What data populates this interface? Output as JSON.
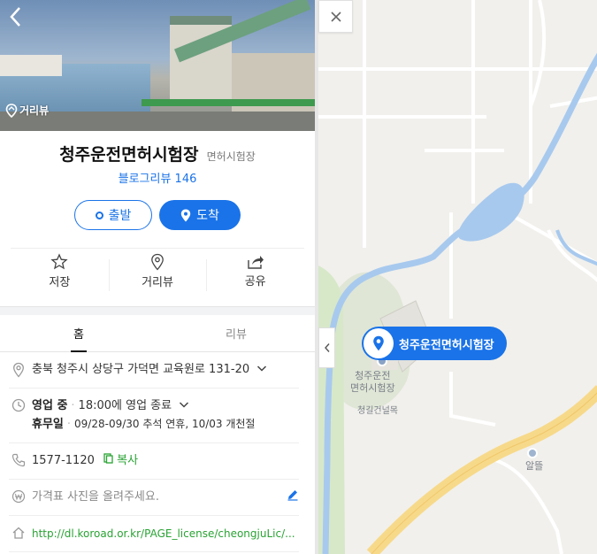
{
  "place": {
    "name": "청주운전면허시험장",
    "category": "면허시험장",
    "blog_review_label": "블로그리뷰 146",
    "roadview_label": "거리뷰"
  },
  "route": {
    "depart_label": "출발",
    "arrive_label": "도착"
  },
  "actions": [
    {
      "label": "저장",
      "icon": "star-icon"
    },
    {
      "label": "거리뷰",
      "icon": "location-pin-icon"
    },
    {
      "label": "공유",
      "icon": "share-icon"
    }
  ],
  "tabs": [
    {
      "label": "홈",
      "active": true
    },
    {
      "label": "리뷰",
      "active": false
    }
  ],
  "info": {
    "address": "충북 청주시 상당구 가덕면 교육원로 131-20",
    "hours_status": "영업 중",
    "hours_detail": "18:00에 영업 종료",
    "holiday_label": "휴무일",
    "holiday_detail": "09/28-09/30 추석 연휴, 10/03 개천절",
    "phone": "1577-1120",
    "copy_label": "복사",
    "price_placeholder": "가격표 사진을 올려주세요.",
    "website": "http://dl.koroad.or.kr/PAGE_license/cheongjuLic/..."
  },
  "map": {
    "pin_label": "청주운전면허시험장",
    "poi_label_line1": "청주운전",
    "poi_label_line2": "면허시험장",
    "road_label": "청길건널목",
    "stop_label": "알뜰"
  },
  "colors": {
    "accent": "#1a73e8",
    "green": "#2aa334",
    "water": "#a8c9ee",
    "park": "#d7e8c9",
    "highway": "#f7d98a"
  }
}
